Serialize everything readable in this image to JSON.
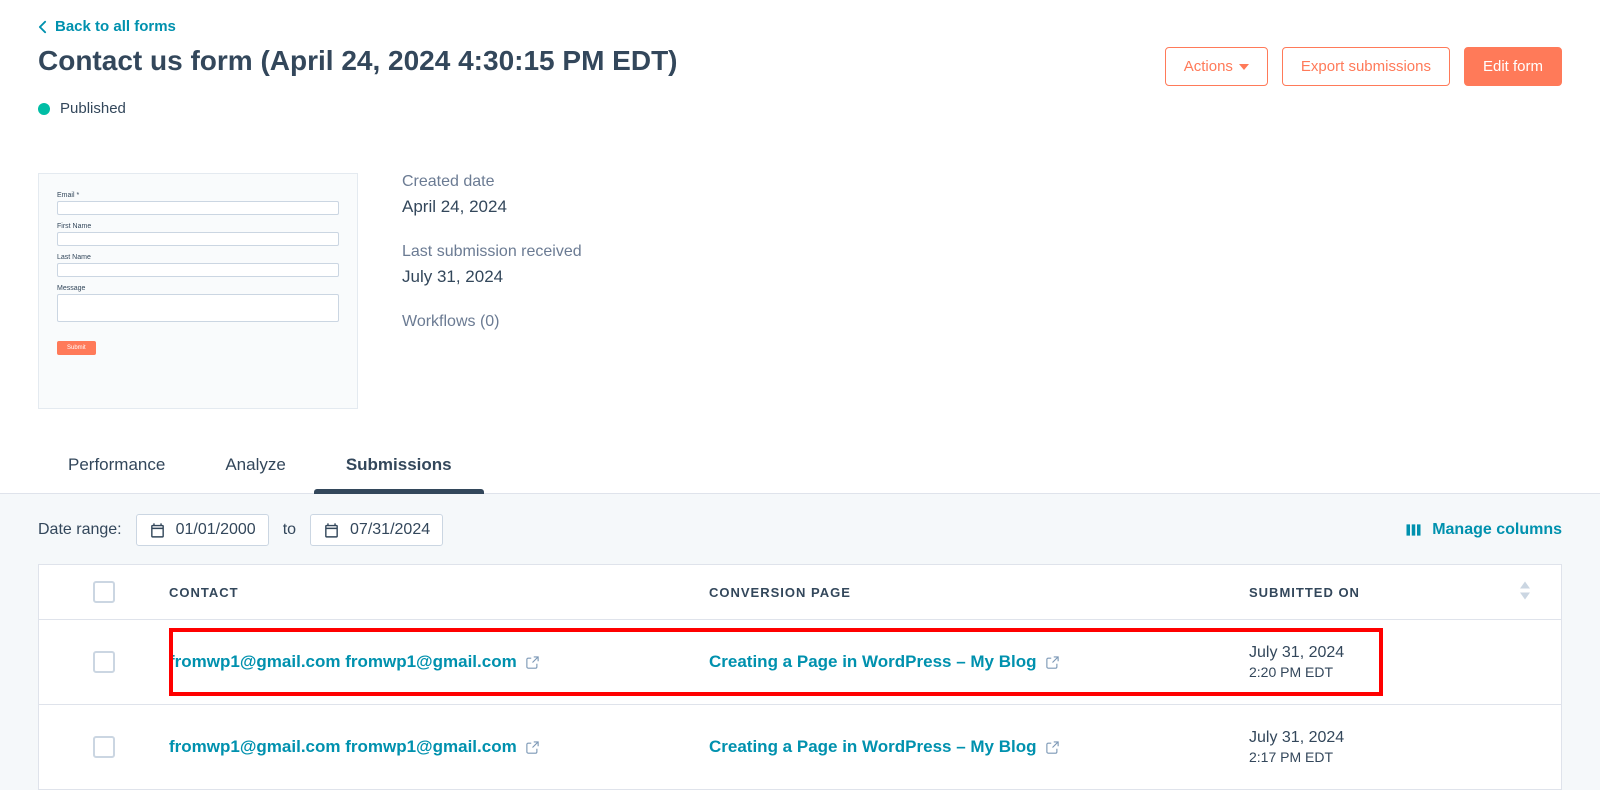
{
  "back_link_label": "Back to all forms",
  "page_title": "Contact us form (April 24, 2024 4:30:15 PM EDT)",
  "status_label": "Published",
  "header_buttons": {
    "actions": "Actions",
    "export": "Export submissions",
    "edit": "Edit form"
  },
  "form_preview": {
    "email_label": "Email *",
    "first_name_label": "First Name",
    "last_name_label": "Last Name",
    "message_label": "Message",
    "submit_label": "Submit"
  },
  "meta": {
    "created_label": "Created date",
    "created_value": "April 24, 2024",
    "last_sub_label": "Last submission received",
    "last_sub_value": "July 31, 2024",
    "workflows_label": "Workflows (0)"
  },
  "tabs": {
    "performance": "Performance",
    "analyze": "Analyze",
    "submissions": "Submissions"
  },
  "filters": {
    "date_range_label": "Date range:",
    "date_from": "01/01/2000",
    "to_label": "to",
    "date_to": "07/31/2024",
    "manage_columns": "Manage columns"
  },
  "table": {
    "headers": {
      "contact": "CONTACT",
      "conversion": "CONVERSION PAGE",
      "submitted": "SUBMITTED ON"
    },
    "rows": [
      {
        "contact": "fromwp1@gmail.com fromwp1@gmail.com",
        "conversion": "Creating a Page in WordPress – My Blog",
        "submitted_date": "July 31, 2024",
        "submitted_time": "2:20 PM EDT",
        "highlighted": true
      },
      {
        "contact": "fromwp1@gmail.com fromwp1@gmail.com",
        "conversion": "Creating a Page in WordPress – My Blog",
        "submitted_date": "July 31, 2024",
        "submitted_time": "2:17 PM EDT",
        "highlighted": false
      }
    ]
  }
}
